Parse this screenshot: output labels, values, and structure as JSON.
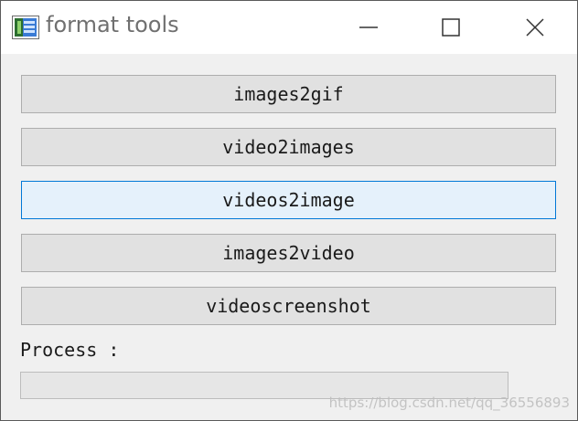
{
  "window": {
    "title": "format tools",
    "controls": [
      "minimize-icon",
      "maximize-icon",
      "close-icon"
    ]
  },
  "buttons": [
    {
      "label": "images2gif"
    },
    {
      "label": "video2images"
    },
    {
      "label": "videos2image",
      "state": "focused"
    },
    {
      "label": "images2video"
    },
    {
      "label": "videoscreenshot"
    }
  ],
  "process": {
    "label": "Process :",
    "progress": 0
  },
  "watermark": "https://blog.csdn.net/qq_36556893",
  "colors": {
    "button_bg": "#e1e1e1",
    "button_border": "#adadad",
    "focused_bg": "#e5f1fb",
    "focused_border": "#0078d7",
    "window_bg": "#f0f0f0"
  }
}
